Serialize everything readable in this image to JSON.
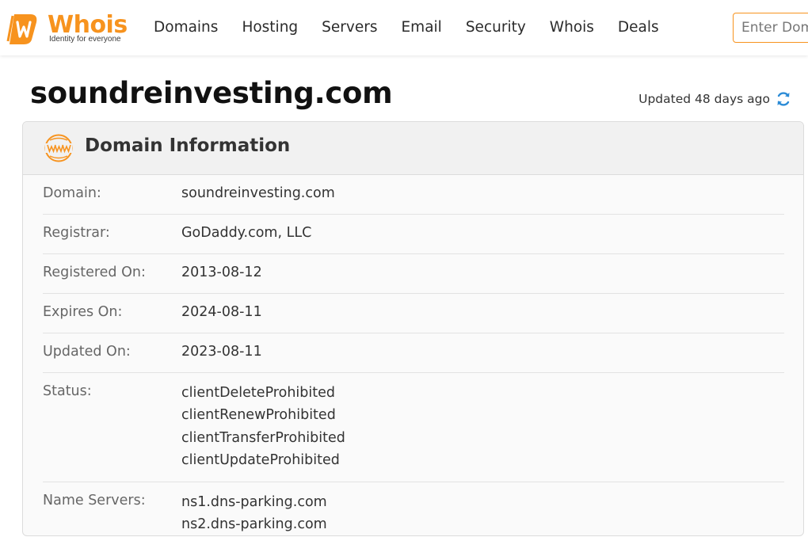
{
  "header": {
    "logo_text": "Whois",
    "logo_tagline": "Identity for everyone",
    "nav": [
      "Domains",
      "Hosting",
      "Servers",
      "Email",
      "Security",
      "Whois",
      "Deals"
    ],
    "search_placeholder": "Enter Domain"
  },
  "page": {
    "title": "soundreinvesting.com",
    "updated_text": "Updated 48 days ago"
  },
  "card": {
    "title": "Domain Information",
    "rows": [
      {
        "label": "Domain:",
        "values": [
          "soundreinvesting.com"
        ]
      },
      {
        "label": "Registrar:",
        "values": [
          "GoDaddy.com, LLC"
        ]
      },
      {
        "label": "Registered On:",
        "values": [
          "2013-08-12"
        ]
      },
      {
        "label": "Expires On:",
        "values": [
          "2024-08-11"
        ]
      },
      {
        "label": "Updated On:",
        "values": [
          "2023-08-11"
        ]
      },
      {
        "label": "Status:",
        "values": [
          "clientDeleteProhibited",
          "clientRenewProhibited",
          "clientTransferProhibited",
          "clientUpdateProhibited"
        ]
      },
      {
        "label": "Name Servers:",
        "values": [
          "ns1.dns-parking.com",
          "ns2.dns-parking.com"
        ]
      }
    ]
  },
  "icons": {
    "logo": "whois-logo-icon",
    "refresh": "refresh-icon",
    "www": "www-globe-icon"
  },
  "colors": {
    "brand_orange": "#f7931e",
    "refresh_blue": "#2b8bd6"
  }
}
